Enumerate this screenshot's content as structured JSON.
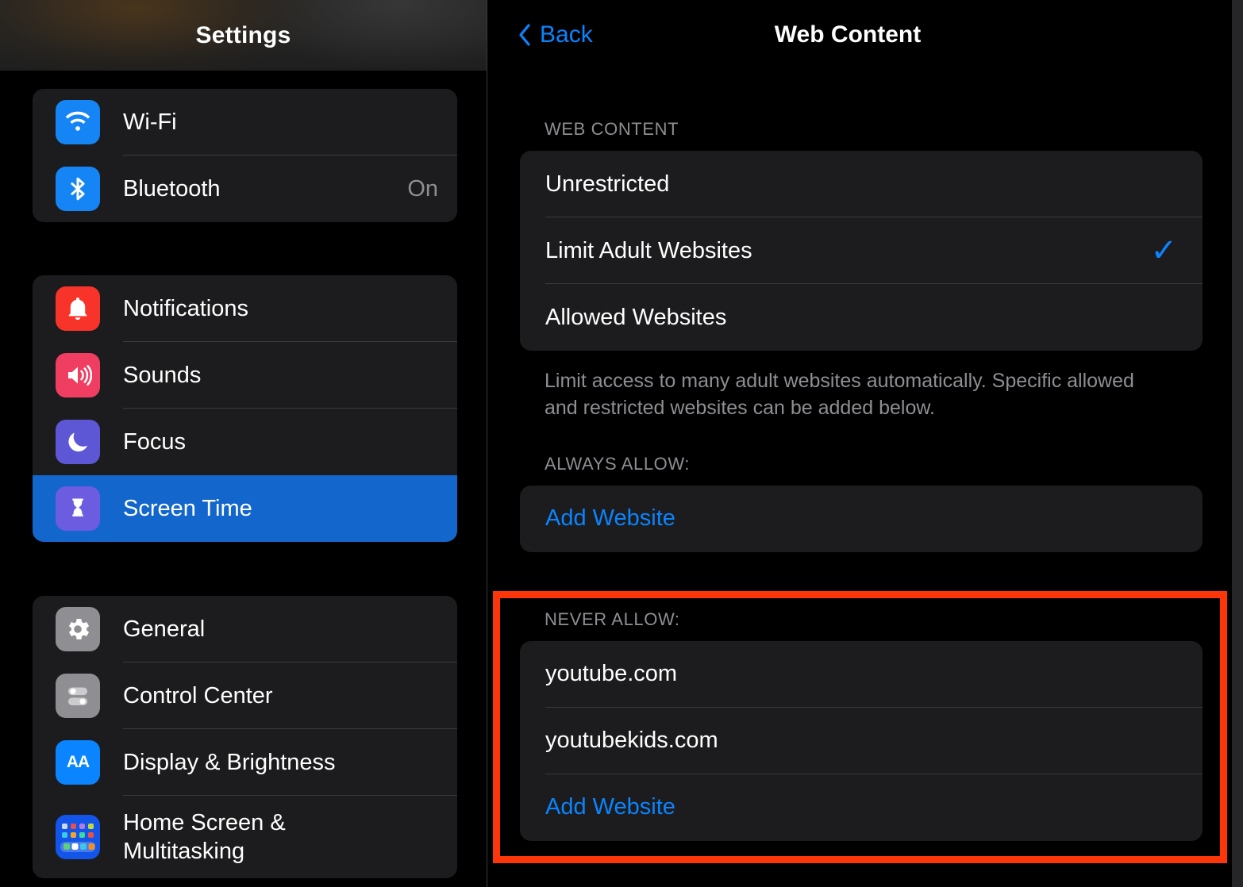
{
  "sidebar": {
    "title": "Settings",
    "partial_row": {
      "icon": "airplane-icon",
      "label": "",
      "toggle": "off"
    },
    "groups": [
      {
        "name": "connectivity",
        "items": [
          {
            "label": "Wi-Fi",
            "icon": "wifi-icon",
            "value": "",
            "selected": false
          },
          {
            "label": "Bluetooth",
            "icon": "bluetooth-icon",
            "value": "On",
            "selected": false
          }
        ]
      },
      {
        "name": "alerts",
        "items": [
          {
            "label": "Notifications",
            "icon": "bell-icon",
            "value": "",
            "selected": false
          },
          {
            "label": "Sounds",
            "icon": "speaker-icon",
            "value": "",
            "selected": false
          },
          {
            "label": "Focus",
            "icon": "moon-icon",
            "value": "",
            "selected": false
          },
          {
            "label": "Screen Time",
            "icon": "hourglass-icon",
            "value": "",
            "selected": true
          }
        ]
      },
      {
        "name": "system",
        "items": [
          {
            "label": "General",
            "icon": "gear-icon",
            "value": "",
            "selected": false
          },
          {
            "label": "Control Center",
            "icon": "toggles-icon",
            "value": "",
            "selected": false
          },
          {
            "label": "Display & Brightness",
            "icon": "aa-icon",
            "value": "",
            "selected": false
          },
          {
            "label": "Home Screen &\nMultitasking",
            "icon": "home-grid-icon",
            "value": "",
            "selected": false
          }
        ]
      }
    ]
  },
  "detail": {
    "back_label": "Back",
    "title": "Web Content",
    "web_content": {
      "section_header": "WEB CONTENT",
      "options": [
        {
          "label": "Unrestricted",
          "checked": false
        },
        {
          "label": "Limit Adult Websites",
          "checked": true
        },
        {
          "label": "Allowed Websites",
          "checked": false
        }
      ],
      "footnote": "Limit access to many adult websites automatically. Specific allowed and restricted websites can be added below."
    },
    "always_allow": {
      "section_header": "ALWAYS ALLOW:",
      "rows": [
        {
          "label": "Add Website",
          "type": "link"
        }
      ]
    },
    "never_allow": {
      "section_header": "NEVER ALLOW:",
      "rows": [
        {
          "label": "youtube.com",
          "type": "text"
        },
        {
          "label": "youtubekids.com",
          "type": "text"
        },
        {
          "label": "Add Website",
          "type": "link"
        }
      ]
    }
  },
  "colors": {
    "accent_blue": "#0a84ff",
    "selection_blue": "#1266cc",
    "annotation_red": "#fc3608",
    "card_bg": "#1c1c1e",
    "secondary_text": "#8e8e93"
  }
}
